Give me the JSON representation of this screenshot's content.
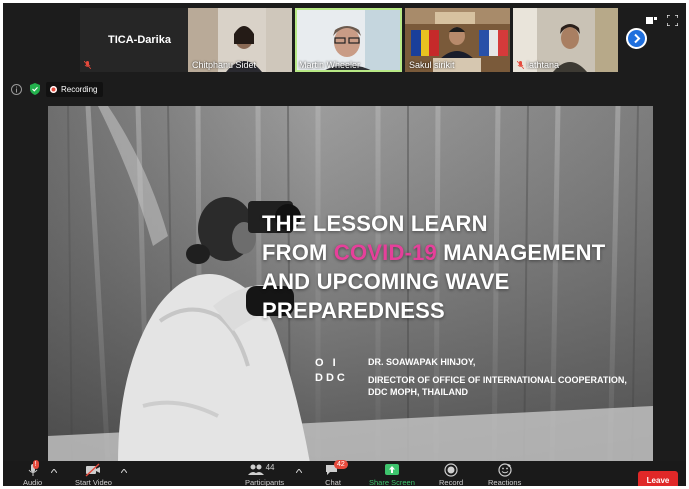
{
  "participants": [
    {
      "name": "TICA-Darika",
      "video": false,
      "muted": true
    },
    {
      "name": "Chitphanu Sidet",
      "video": true,
      "muted": false
    },
    {
      "name": "Martin Wheeler",
      "video": true,
      "muted": false,
      "active": true
    },
    {
      "name": "Sakul sirikit",
      "video": true,
      "muted": false
    },
    {
      "name": "lathtana",
      "video": true,
      "muted": true
    }
  ],
  "recording": {
    "label": "Recording"
  },
  "slide": {
    "title_line1": "THE LESSON LEARN",
    "title_line2_pre": "FROM ",
    "title_line2_highlight": "COVID-19",
    "title_line2_post": " MANAGEMENT",
    "title_line3": "AND UPCOMING WAVE",
    "title_line4": "PREPAREDNESS",
    "logo_top": "O I",
    "logo_bottom": "DDC",
    "presenter_name": "DR. SOAWAPAK HINJOY,",
    "presenter_role": "DIRECTOR OF OFFICE OF INTERNATIONAL COOPERATION,",
    "presenter_org": "DDC MOPH, THAILAND",
    "highlight_color": "#e5409a"
  },
  "toolbar": {
    "audio": "Audio",
    "start_video": "Start Video",
    "participants": "Participants",
    "participants_count": "44",
    "chat": "Chat",
    "chat_badge": "42",
    "share_screen": "Share Screen",
    "record": "Record",
    "reactions": "Reactions",
    "leave": "Leave"
  },
  "colors": {
    "leave": "#e02828",
    "share": "#3ec46d",
    "record_dot": "#e64a3c",
    "next_button": "#1f6fdd"
  }
}
